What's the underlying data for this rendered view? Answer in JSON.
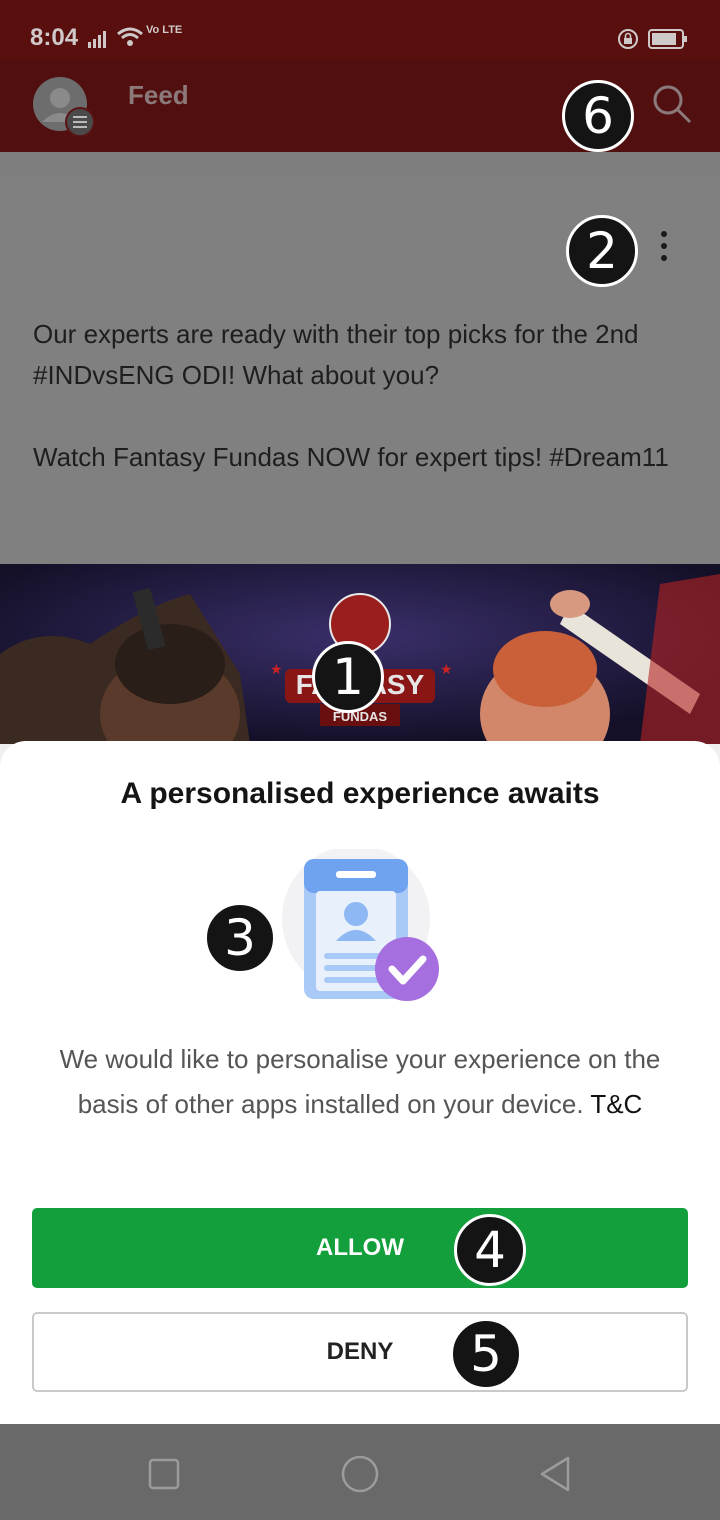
{
  "status_bar": {
    "time": "8:04",
    "network": "Vo LTE"
  },
  "app_bar": {
    "title": "Feed"
  },
  "post": {
    "line1": "Our experts are ready with their top picks for the 2nd #INDvsENG ODI! What about you?",
    "line2": "Watch Fantasy Fundas NOW for expert tips! #Dream11",
    "banner_title": "FANTASY",
    "banner_subtitle": "FUNDAS"
  },
  "sheet": {
    "title": "A personalised experience awaits",
    "body": "We would like to personalise your experience on the basis of other apps installed on your device.",
    "link": "T&C",
    "allow_label": "ALLOW",
    "deny_label": "DENY"
  },
  "badges": [
    "1",
    "2",
    "3",
    "4",
    "5",
    "6"
  ],
  "colors": {
    "header": "#520f10",
    "allow": "#13a03c",
    "check_badge": "#a66fe0",
    "card_blue": "#8db8f3"
  }
}
